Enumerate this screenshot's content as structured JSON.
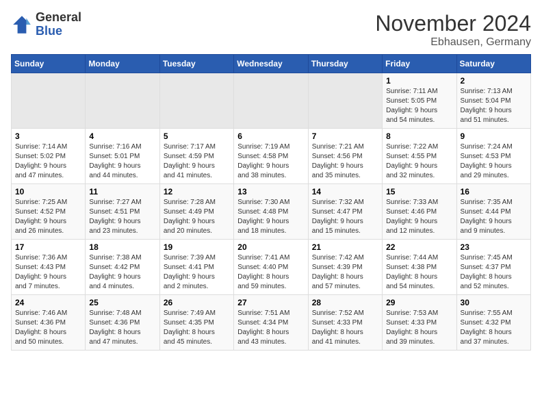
{
  "header": {
    "logo_general": "General",
    "logo_blue": "Blue",
    "month_title": "November 2024",
    "location": "Ebhausen, Germany"
  },
  "weekdays": [
    "Sunday",
    "Monday",
    "Tuesday",
    "Wednesday",
    "Thursday",
    "Friday",
    "Saturday"
  ],
  "weeks": [
    [
      {
        "day": "",
        "info": ""
      },
      {
        "day": "",
        "info": ""
      },
      {
        "day": "",
        "info": ""
      },
      {
        "day": "",
        "info": ""
      },
      {
        "day": "",
        "info": ""
      },
      {
        "day": "1",
        "info": "Sunrise: 7:11 AM\nSunset: 5:05 PM\nDaylight: 9 hours\nand 54 minutes."
      },
      {
        "day": "2",
        "info": "Sunrise: 7:13 AM\nSunset: 5:04 PM\nDaylight: 9 hours\nand 51 minutes."
      }
    ],
    [
      {
        "day": "3",
        "info": "Sunrise: 7:14 AM\nSunset: 5:02 PM\nDaylight: 9 hours\nand 47 minutes."
      },
      {
        "day": "4",
        "info": "Sunrise: 7:16 AM\nSunset: 5:01 PM\nDaylight: 9 hours\nand 44 minutes."
      },
      {
        "day": "5",
        "info": "Sunrise: 7:17 AM\nSunset: 4:59 PM\nDaylight: 9 hours\nand 41 minutes."
      },
      {
        "day": "6",
        "info": "Sunrise: 7:19 AM\nSunset: 4:58 PM\nDaylight: 9 hours\nand 38 minutes."
      },
      {
        "day": "7",
        "info": "Sunrise: 7:21 AM\nSunset: 4:56 PM\nDaylight: 9 hours\nand 35 minutes."
      },
      {
        "day": "8",
        "info": "Sunrise: 7:22 AM\nSunset: 4:55 PM\nDaylight: 9 hours\nand 32 minutes."
      },
      {
        "day": "9",
        "info": "Sunrise: 7:24 AM\nSunset: 4:53 PM\nDaylight: 9 hours\nand 29 minutes."
      }
    ],
    [
      {
        "day": "10",
        "info": "Sunrise: 7:25 AM\nSunset: 4:52 PM\nDaylight: 9 hours\nand 26 minutes."
      },
      {
        "day": "11",
        "info": "Sunrise: 7:27 AM\nSunset: 4:51 PM\nDaylight: 9 hours\nand 23 minutes."
      },
      {
        "day": "12",
        "info": "Sunrise: 7:28 AM\nSunset: 4:49 PM\nDaylight: 9 hours\nand 20 minutes."
      },
      {
        "day": "13",
        "info": "Sunrise: 7:30 AM\nSunset: 4:48 PM\nDaylight: 9 hours\nand 18 minutes."
      },
      {
        "day": "14",
        "info": "Sunrise: 7:32 AM\nSunset: 4:47 PM\nDaylight: 9 hours\nand 15 minutes."
      },
      {
        "day": "15",
        "info": "Sunrise: 7:33 AM\nSunset: 4:46 PM\nDaylight: 9 hours\nand 12 minutes."
      },
      {
        "day": "16",
        "info": "Sunrise: 7:35 AM\nSunset: 4:44 PM\nDaylight: 9 hours\nand 9 minutes."
      }
    ],
    [
      {
        "day": "17",
        "info": "Sunrise: 7:36 AM\nSunset: 4:43 PM\nDaylight: 9 hours\nand 7 minutes."
      },
      {
        "day": "18",
        "info": "Sunrise: 7:38 AM\nSunset: 4:42 PM\nDaylight: 9 hours\nand 4 minutes."
      },
      {
        "day": "19",
        "info": "Sunrise: 7:39 AM\nSunset: 4:41 PM\nDaylight: 9 hours\nand 2 minutes."
      },
      {
        "day": "20",
        "info": "Sunrise: 7:41 AM\nSunset: 4:40 PM\nDaylight: 8 hours\nand 59 minutes."
      },
      {
        "day": "21",
        "info": "Sunrise: 7:42 AM\nSunset: 4:39 PM\nDaylight: 8 hours\nand 57 minutes."
      },
      {
        "day": "22",
        "info": "Sunrise: 7:44 AM\nSunset: 4:38 PM\nDaylight: 8 hours\nand 54 minutes."
      },
      {
        "day": "23",
        "info": "Sunrise: 7:45 AM\nSunset: 4:37 PM\nDaylight: 8 hours\nand 52 minutes."
      }
    ],
    [
      {
        "day": "24",
        "info": "Sunrise: 7:46 AM\nSunset: 4:36 PM\nDaylight: 8 hours\nand 50 minutes."
      },
      {
        "day": "25",
        "info": "Sunrise: 7:48 AM\nSunset: 4:36 PM\nDaylight: 8 hours\nand 47 minutes."
      },
      {
        "day": "26",
        "info": "Sunrise: 7:49 AM\nSunset: 4:35 PM\nDaylight: 8 hours\nand 45 minutes."
      },
      {
        "day": "27",
        "info": "Sunrise: 7:51 AM\nSunset: 4:34 PM\nDaylight: 8 hours\nand 43 minutes."
      },
      {
        "day": "28",
        "info": "Sunrise: 7:52 AM\nSunset: 4:33 PM\nDaylight: 8 hours\nand 41 minutes."
      },
      {
        "day": "29",
        "info": "Sunrise: 7:53 AM\nSunset: 4:33 PM\nDaylight: 8 hours\nand 39 minutes."
      },
      {
        "day": "30",
        "info": "Sunrise: 7:55 AM\nSunset: 4:32 PM\nDaylight: 8 hours\nand 37 minutes."
      }
    ]
  ]
}
